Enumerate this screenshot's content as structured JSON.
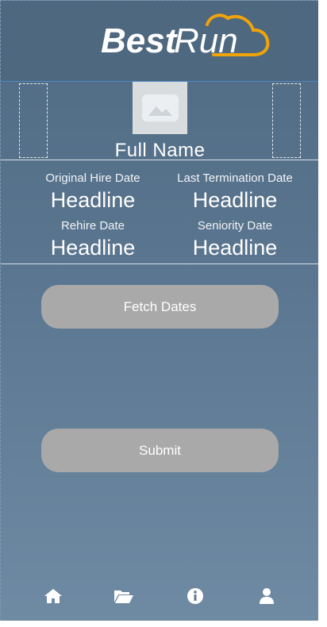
{
  "header": {
    "brand_first": "Best",
    "brand_second": "Run"
  },
  "profile": {
    "full_name": "Full Name",
    "avatar_icon": "image-placeholder-icon"
  },
  "dates": {
    "original_hire": {
      "label": "Original Hire Date",
      "value": "Headline"
    },
    "last_termination": {
      "label": "Last Termination Date",
      "value": "Headline"
    },
    "rehire": {
      "label": "Rehire Date",
      "value": "Headline"
    },
    "seniority": {
      "label": "Seniority Date",
      "value": "Headline"
    }
  },
  "actions": {
    "fetch_label": "Fetch Dates",
    "submit_label": "Submit"
  },
  "tabbar": {
    "items": [
      {
        "icon": "home-icon"
      },
      {
        "icon": "folder-open-icon"
      },
      {
        "icon": "info-icon"
      },
      {
        "icon": "user-icon"
      }
    ]
  },
  "colors": {
    "header_bg": "#4e6880",
    "gradient_top": "#4f6a82",
    "gradient_bottom": "#6f8aa3",
    "button_bg": "#a9a9aa",
    "logo_accent": "#f0a30a"
  }
}
